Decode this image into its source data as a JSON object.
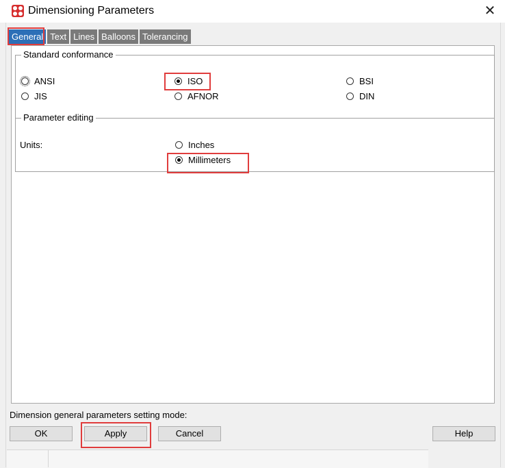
{
  "window": {
    "title": "Dimensioning Parameters",
    "close_glyph": "✕"
  },
  "tabs": [
    {
      "label": "General",
      "active": true
    },
    {
      "label": "Text",
      "active": false
    },
    {
      "label": "Lines",
      "active": false
    },
    {
      "label": "Balloons",
      "active": false
    },
    {
      "label": "Tolerancing",
      "active": false
    }
  ],
  "standard_conformance": {
    "label": "Standard conformance",
    "options": [
      {
        "label": "ANSI",
        "checked": false
      },
      {
        "label": "ISO",
        "checked": true
      },
      {
        "label": "BSI",
        "checked": false
      },
      {
        "label": "JIS",
        "checked": false
      },
      {
        "label": "AFNOR",
        "checked": false
      },
      {
        "label": "DIN",
        "checked": false
      }
    ]
  },
  "parameter_editing": {
    "label": "Parameter editing",
    "units_label": "Units:",
    "options": [
      {
        "label": "Inches",
        "checked": false
      },
      {
        "label": "Millimeters",
        "checked": true
      }
    ]
  },
  "status": {
    "text": "Dimension general parameters setting mode:"
  },
  "buttons": {
    "ok": "OK",
    "apply": "Apply",
    "cancel": "Cancel",
    "help": "Help"
  },
  "colors": {
    "highlight": "#e03c3c",
    "active_tab": "#2c6fb7",
    "inactive_tab": "#7a7a7a"
  }
}
